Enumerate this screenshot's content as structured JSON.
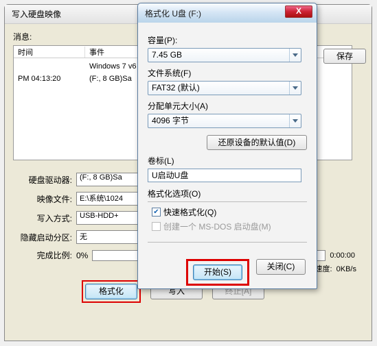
{
  "back": {
    "title": "写入硬盘映像",
    "msg_label": "消息:",
    "save_btn": "保存",
    "log": {
      "col_time": "时间",
      "col_event": "事件",
      "rows": [
        {
          "time": "",
          "event": "Windows 7 v6"
        },
        {
          "time": "PM 04:13:20",
          "event": "(F:, 8 GB)Sa"
        }
      ]
    },
    "fields": {
      "drive_label": "硬盘驱动器:",
      "drive_value": "(F:, 8 GB)Sa",
      "image_label": "映像文件:",
      "image_value": "E:\\系统\\1024",
      "write_label": "写入方式:",
      "write_value": "USB-HDD+",
      "hidden_label": "隐藏启动分区:",
      "hidden_value": "无"
    },
    "progress_label": "完成比例:",
    "progress_value": "0%",
    "progress_rest": "0:00:00",
    "speed_label": "速度:",
    "speed_value": "0KB/s",
    "btn_format": "格式化",
    "btn_write": "写入",
    "btn_abort": "终止[A]"
  },
  "dlg": {
    "title": "格式化        U盘 (F:)",
    "close": "X",
    "capacity_label": "容量(P):",
    "capacity_value": "7.45 GB",
    "fs_label": "文件系统(F)",
    "fs_value": "FAT32 (默认)",
    "alloc_label": "分配单元大小(A)",
    "alloc_value": "4096 字节",
    "restore_btn": "还原设备的默认值(D)",
    "vol_label": "卷标(L)",
    "vol_value": "U启动U盘",
    "opts_title": "格式化选项(O)",
    "quick_label": "快速格式化(Q)",
    "msdos_label": "创建一个 MS-DOS 启动盘(M)",
    "start_btn": "开始(S)",
    "close_btn": "关闭(C)"
  }
}
